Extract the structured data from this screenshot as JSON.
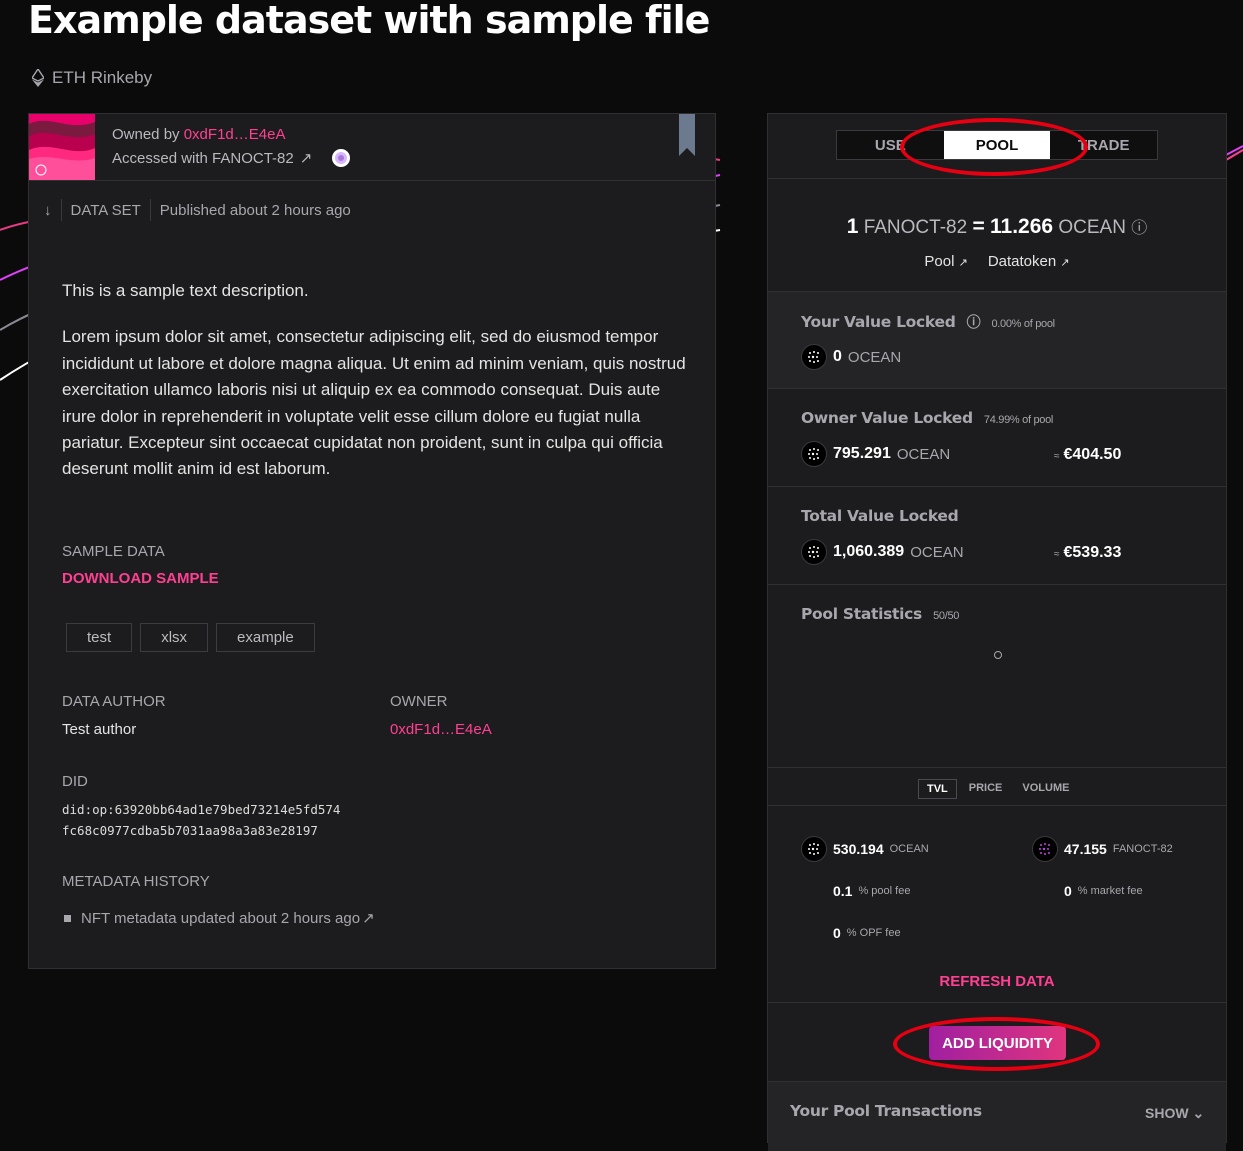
{
  "title": "Example dataset with sample file",
  "network": "ETH Rinkeby",
  "asset": {
    "owned_by_label": "Owned by",
    "owner_short": "0xdF1d…E4eA",
    "accessed_label": "Accessed with FANOCT-82",
    "type": "DATA SET",
    "published": "Published about 2 hours ago",
    "description_1": "This is a sample text description.",
    "description_2": "Lorem ipsum dolor sit amet, consectetur adipiscing elit, sed do eiusmod tempor incididunt ut labore et dolore magna aliqua. Ut enim ad minim veniam, quis nostrud exercitation ullamco laboris nisi ut aliquip ex ea commodo consequat. Duis aute irure dolor in reprehenderit in voluptate velit esse cillum dolore eu fugiat nulla pariatur. Excepteur sint occaecat cupidatat non proident, sunt in culpa qui officia deserunt mollit anim id est laborum.",
    "sample_label": "SAMPLE DATA",
    "download_label": "DOWNLOAD SAMPLE",
    "tags": [
      "test",
      "xlsx",
      "example"
    ],
    "author_label": "DATA AUTHOR",
    "author": "Test author",
    "owner_label": "OWNER",
    "owner": "0xdF1d…E4eA",
    "did_label": "DID",
    "did_line1": "did:op:63920bb64ad1e79bed73214e5fd574",
    "did_line2": "fc68c0977cdba5b7031aa98a3a83e28197",
    "history_label": "METADATA HISTORY",
    "history_item": "NFT metadata updated about 2 hours ago"
  },
  "pool": {
    "tabs": [
      "USE",
      "POOL",
      "TRADE"
    ],
    "active_tab": "POOL",
    "price_qty": "1",
    "price_token": "FANOCT-82",
    "price_eq": "=",
    "price_value": "11.266",
    "price_unit": "OCEAN",
    "link_pool": "Pool",
    "link_datatoken": "Datatoken",
    "your_value_title": "Your Value Locked",
    "your_value_pct": "0.00% of pool",
    "your_value_amount": "0",
    "owner_value_title": "Owner Value Locked",
    "owner_value_pct": "74.99% of pool",
    "owner_value_amount": "795.291",
    "owner_value_eur": "€404.50",
    "total_value_title": "Total Value Locked",
    "total_value_amount": "1,060.389",
    "total_value_eur": "€539.33",
    "ocean_label": "OCEAN",
    "approx": "≈",
    "stats_title": "Pool Statistics",
    "stats_weight": "50/50",
    "chart_tabs": [
      "TVL",
      "PRICE",
      "VOLUME"
    ],
    "ocean_reserve": "530.194",
    "ocean_reserve_unit": "OCEAN",
    "dt_reserve": "47.155",
    "dt_reserve_unit": "FANOCT-82",
    "pool_fee": "0.1",
    "pool_fee_label": "% pool fee",
    "market_fee": "0",
    "market_fee_label": "% market fee",
    "opf_fee": "0",
    "opf_fee_label": "% OPF fee",
    "refresh": "REFRESH DATA",
    "add_liquidity": "ADD LIQUIDITY",
    "tx_title": "Your Pool Transactions",
    "show": "SHOW"
  },
  "colors": {
    "accent": "#ff4092",
    "annotation": "#e60012",
    "background": "#0b0b0c",
    "card": "#1c1c1e"
  }
}
